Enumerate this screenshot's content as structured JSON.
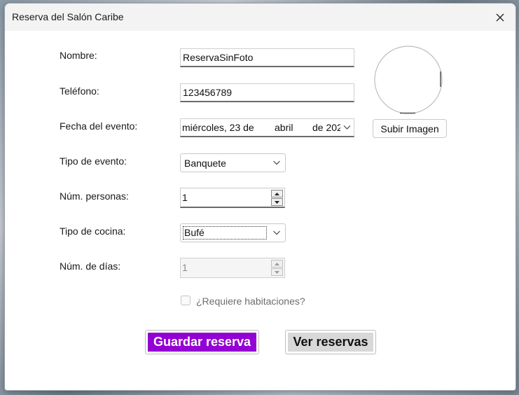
{
  "window": {
    "title": "Reserva del Salón Caribe"
  },
  "form": {
    "nombre": {
      "label": "Nombre:",
      "value": "ReservaSinFoto"
    },
    "telefono": {
      "label": "Teléfono:",
      "value": "123456789"
    },
    "fecha": {
      "label": "Fecha del evento:",
      "day": "miércoles, 23 de",
      "month": "abril",
      "year": "de 202"
    },
    "tipo_evento": {
      "label": "Tipo de evento:",
      "value": "Banquete"
    },
    "num_personas": {
      "label": "Núm. personas:",
      "value": "1"
    },
    "tipo_cocina": {
      "label": "Tipo de cocina:",
      "value": "Bufé"
    },
    "num_dias": {
      "label": "Núm. de días:",
      "value": "1",
      "enabled": false
    },
    "habitaciones": {
      "label": "¿Requiere habitaciones?",
      "checked": false,
      "enabled": false
    }
  },
  "image": {
    "upload_label": "Subir Imagen"
  },
  "actions": {
    "guardar": {
      "label": "Guardar reserva",
      "color": "#9400d3",
      "text_color": "#ffffff"
    },
    "ver": {
      "label": "Ver reservas",
      "color": "#d8d8d8",
      "text_color": "#111111"
    }
  }
}
